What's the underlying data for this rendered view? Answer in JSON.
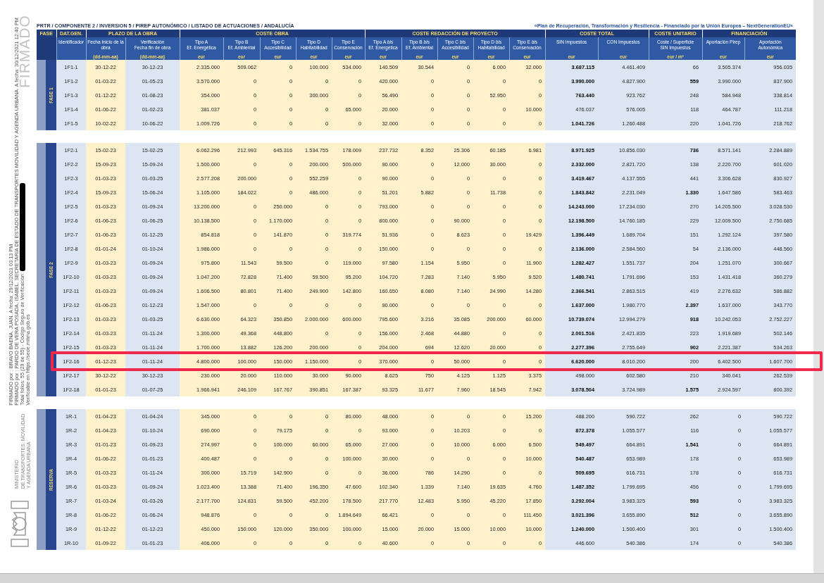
{
  "margin": {
    "stamp": "FIRMADO",
    "ministry": [
      "MINISTERIO",
      "DE TRANSPORTES, MOVILIDAD",
      "Y AGENDA URBANA"
    ],
    "signature_lines": [
      {
        "text": "FIRMADO por : BRAVO BAENA, JUAN. A fecha: 29/12/2021 03:13 PM",
        "redaction": false
      },
      {
        "text": "FIRMADO por : PARDO DE VERA POSADA, ISABEL. SECRETARIA DE ESTADO DE TRANSPORTES MOVILIDAD Y AGENDA URBANA. A fecha: 30/12/2021 12:40 PM",
        "redaction": false
      },
      {
        "text": "Total folios: 55 (29 de 55) - Código Seguro de Verificación:",
        "redaction": true
      },
      {
        "text": "Verificable en https://sede.mitma.gob.es",
        "redaction": false
      }
    ]
  },
  "breadcrumb": "PRTR / COMPONENTE 2 / INVERSION 5 / PIREP AUTONÓMICO / LISTADO DE ACTUACIONES / ANDALUCÍA",
  "funding_note": "«Plan de Recuperación, Transformación y Resiliencia - Financiado por la Unión Europea – NextGenerationEU»",
  "table": {
    "phase_header": "FASE",
    "groups": [
      {
        "label": "DAT.GEN."
      },
      {
        "label": "PLAZO DE LA OBRA"
      },
      {
        "label": "COSTE OBRA"
      },
      {
        "label": "COSTE REDACCIÓN DE PROYECTO"
      },
      {
        "label": "COSTE TOTAL"
      },
      {
        "label": "COSTE UNITARIO"
      },
      {
        "label": "FINANCIACIÓN"
      }
    ],
    "columns": [
      {
        "label": "Identificador"
      },
      {
        "label": "Fecha inicio de la\nobra",
        "unit": "(dd-mm-aa)"
      },
      {
        "label": "Verificación\nFecha fin de obra",
        "unit": "(dd-mm-aa)"
      },
      {
        "label": "Tipo A\nEf. Energética",
        "unit": "eur"
      },
      {
        "label": "Tipo B\nEf. Ambiental",
        "unit": "eur"
      },
      {
        "label": "Tipo C\nAccesibilidad",
        "unit": "eur"
      },
      {
        "label": "Tipo D\nHabitabilidad",
        "unit": "eur"
      },
      {
        "label": "Tipo E\nConservación",
        "unit": "eur"
      },
      {
        "label": "Tipo A *bis*\nEf. Energética",
        "unit": "eur"
      },
      {
        "label": "Tipo B *bis*\nEf. Ambiental",
        "unit": "eur"
      },
      {
        "label": "Tipo C *bis*\nAccesibilidad",
        "unit": "eur"
      },
      {
        "label": "Tipo D *bis*\nHabitabilidad",
        "unit": "eur"
      },
      {
        "label": "Tipo E *bis*\nConservación",
        "unit": "eur"
      },
      {
        "label": "SIN Impuestos",
        "unit": "eur"
      },
      {
        "label": "CON Impuestos",
        "unit": "eur"
      },
      {
        "label": "Coste / Superficie\nSIN Impuestos",
        "unit": "eur / m²"
      },
      {
        "label": "Aportación Pirep",
        "unit": "eur"
      },
      {
        "label": "Aportación\nAutonómica",
        "unit": "eur"
      }
    ],
    "sections": [
      {
        "label": "FASE 1",
        "rows": [
          {
            "cells": [
              "1F1-1",
              "30-12-22",
              "30-12-23",
              "2.335.000",
              "509.062",
              "0",
              "100.000",
              "534.000",
              "140.509",
              "30.544",
              "0",
              "6.000",
              "32.000",
              "3.687.115",
              "4.461.409",
              "66",
              "3.505.374",
              "956.035"
            ],
            "sin_bold": true,
            "unit_bold": false,
            "highlighted": false
          },
          {
            "cells": [
              "1F1-2",
              "01-03-22",
              "01-05-23",
              "3.570.000",
              "0",
              "0",
              "0",
              "0",
              "420.000",
              "0",
              "0",
              "0",
              "0",
              "3.990.000",
              "4.827.900",
              "559",
              "3.990.000",
              "837.900"
            ],
            "sin_bold": true,
            "unit_bold": true,
            "highlighted": false
          },
          {
            "cells": [
              "1F1-3",
              "01-12-22",
              "01-08-23",
              "354.000",
              "0",
              "0",
              "300.000",
              "0",
              "56.490",
              "0",
              "0",
              "52.950",
              "0",
              "763.440",
              "923.762",
              "248",
              "584.948",
              "338.814"
            ],
            "sin_bold": true,
            "unit_bold": false,
            "highlighted": false
          },
          {
            "cells": [
              "1F1-4",
              "01-06-22",
              "01-02-23",
              "381.037",
              "0",
              "0",
              "0",
              "65.000",
              "20.000",
              "0",
              "0",
              "0",
              "10.000",
              "476.037",
              "576.005",
              "118",
              "464.787",
              "111.218"
            ],
            "sin_bold": false,
            "unit_bold": false,
            "highlighted": false
          },
          {
            "cells": [
              "1F1-5",
              "10-02-22",
              "10-06-22",
              "1.009.726",
              "0",
              "0",
              "0",
              "0",
              "32.000",
              "0",
              "0",
              "0",
              "0",
              "1.041.726",
              "1.260.488",
              "220",
              "1.041.726",
              "218.762"
            ],
            "sin_bold": true,
            "unit_bold": false,
            "highlighted": false
          }
        ]
      },
      {
        "label": "FASE 2",
        "rows": [
          {
            "cells": [
              "1F2-1",
              "15-02-23",
              "15-02-25",
              "6.062.296",
              "212.993",
              "645.316",
              "1.534.755",
              "178.009",
              "237.732",
              "8.352",
              "25.306",
              "60.185",
              "6.981",
              "8.971.925",
              "10.856.030",
              "736",
              "8.571.141",
              "2.284.889"
            ],
            "sin_bold": true,
            "unit_bold": true,
            "highlighted": false
          },
          {
            "cells": [
              "1F2-2",
              "15-09-23",
              "15-09-24",
              "1.500.000",
              "0",
              "0",
              "200.000",
              "500.000",
              "90.000",
              "0",
              "12.000",
              "30.000",
              "0",
              "2.332.000",
              "2.821.720",
              "138",
              "2.220.700",
              "601.020"
            ],
            "sin_bold": true,
            "unit_bold": false,
            "highlighted": false
          },
          {
            "cells": [
              "1F2-3",
              "01-03-23",
              "01-03-25",
              "2.577.208",
              "200.000",
              "0",
              "552.259",
              "0",
              "90.000",
              "0",
              "0",
              "0",
              "0",
              "3.419.467",
              "4.137.555",
              "441",
              "3.306.628",
              "830.927"
            ],
            "sin_bold": true,
            "unit_bold": false,
            "highlighted": false
          },
          {
            "cells": [
              "1F2-4",
              "15-09-23",
              "15-06-24",
              "1.105.000",
              "184.022",
              "0",
              "486.000",
              "0",
              "51.201",
              "5.882",
              "0",
              "11.738",
              "0",
              "1.843.842",
              "2.231.049",
              "1.330",
              "1.647.586",
              "583.463"
            ],
            "sin_bold": true,
            "unit_bold": true,
            "highlighted": false
          },
          {
            "cells": [
              "1F2-5",
              "01-03-23",
              "01-09-24",
              "13.200.000",
              "0",
              "250.000",
              "0",
              "0",
              "793.000",
              "0",
              "0",
              "0",
              "0",
              "14.243.000",
              "17.234.030",
              "270",
              "14.205.500",
              "3.028.530"
            ],
            "sin_bold": true,
            "unit_bold": false,
            "highlighted": false
          },
          {
            "cells": [
              "1F2-6",
              "01-06-23",
              "01-06-25",
              "10.138.500",
              "0",
              "1.170.000",
              "0",
              "0",
              "800.000",
              "0",
              "90.000",
              "0",
              "0",
              "12.198.500",
              "14.760.185",
              "229",
              "12.009.500",
              "2.750.685"
            ],
            "sin_bold": true,
            "unit_bold": false,
            "highlighted": false
          },
          {
            "cells": [
              "1F2-7",
              "01-06-23",
              "01-12-25",
              "854.818",
              "0",
              "141.870",
              "0",
              "319.774",
              "51.936",
              "0",
              "8.623",
              "0",
              "19.429",
              "1.396.449",
              "1.689.704",
              "151",
              "1.292.124",
              "397.580"
            ],
            "sin_bold": true,
            "unit_bold": false,
            "highlighted": false
          },
          {
            "cells": [
              "1F2-8",
              "01-01-24",
              "01-10-24",
              "1.986.000",
              "0",
              "0",
              "0",
              "0",
              "150.000",
              "0",
              "0",
              "0",
              "0",
              "2.136.000",
              "2.584.560",
              "54",
              "2.136.000",
              "448.560"
            ],
            "sin_bold": true,
            "unit_bold": false,
            "highlighted": false
          },
          {
            "cells": [
              "1F2-9",
              "01-03-23",
              "01-09-24",
              "975.800",
              "11.543",
              "59.500",
              "0",
              "119.000",
              "97.580",
              "1.154",
              "5.950",
              "0",
              "11.900",
              "1.282.427",
              "1.551.737",
              "204",
              "1.251.070",
              "300.667"
            ],
            "sin_bold": true,
            "unit_bold": false,
            "highlighted": false
          },
          {
            "cells": [
              "1F2-10",
              "01-03-23",
              "01-09-24",
              "1.047.200",
              "72.828",
              "71.400",
              "59.500",
              "95.200",
              "104.720",
              "7.283",
              "7.140",
              "5.950",
              "9.520",
              "1.480.741",
              "1.791.696",
              "153",
              "1.431.418",
              "360.279"
            ],
            "sin_bold": true,
            "unit_bold": false,
            "highlighted": false
          },
          {
            "cells": [
              "1F2-11",
              "01-03-23",
              "01-09-24",
              "1.606.500",
              "80.801",
              "71.400",
              "249.900",
              "142.800",
              "160.650",
              "8.080",
              "7.140",
              "24.990",
              "14.280",
              "2.366.541",
              "2.863.515",
              "419",
              "2.276.632",
              "586.882"
            ],
            "sin_bold": true,
            "unit_bold": false,
            "highlighted": false
          },
          {
            "cells": [
              "1F2-12",
              "01-06-23",
              "01-12-23",
              "1.547.000",
              "0",
              "0",
              "0",
              "0",
              "90.000",
              "0",
              "0",
              "0",
              "0",
              "1.637.000",
              "1.980.770",
              "2.397",
              "1.637.000",
              "343.770"
            ],
            "sin_bold": true,
            "unit_bold": true,
            "highlighted": false
          },
          {
            "cells": [
              "1F2-13",
              "01-03-23",
              "01-03-25",
              "6.630.000",
              "64.323",
              "350.850",
              "2.000.000",
              "600.000",
              "795.600",
              "3.216",
              "35.085",
              "200.000",
              "60.000",
              "10.739.074",
              "12.994.279",
              "918",
              "10.242.053",
              "2.752.227"
            ],
            "sin_bold": true,
            "unit_bold": true,
            "highlighted": false
          },
          {
            "cells": [
              "1F2-14",
              "01-03-23",
              "01-11-24",
              "1.300.000",
              "49.368",
              "448.800",
              "0",
              "0",
              "156.000",
              "2.468",
              "44.880",
              "0",
              "0",
              "2.001.516",
              "2.421.835",
              "223",
              "1.919.689",
              "502.146"
            ],
            "sin_bold": true,
            "unit_bold": false,
            "highlighted": false
          },
          {
            "cells": [
              "1F2-15",
              "01-03-23",
              "01-11-24",
              "1.700.000",
              "13.882",
              "126.200",
              "200.000",
              "0",
              "204.000",
              "694",
              "12.620",
              "20.000",
              "0",
              "2.277.396",
              "2.755.649",
              "902",
              "2.221.387",
              "534.263"
            ],
            "sin_bold": true,
            "unit_bold": true,
            "highlighted": false
          },
          {
            "cells": [
              "1F2-16",
              "01-12-23",
              "01-11-24",
              "4.800.000",
              "100.000",
              "150.000",
              "1.150.000",
              "0",
              "370.000",
              "0",
              "50.000",
              "0",
              "0",
              "6.620.000",
              "8.010.200",
              "200",
              "6.402.500",
              "1.607.700"
            ],
            "sin_bold": true,
            "unit_bold": false,
            "highlighted": true
          },
          {
            "cells": [
              "1F2-17",
              "30-12-22",
              "30-12-23",
              "230.000",
              "20.000",
              "110.000",
              "30.000",
              "90.000",
              "8.625",
              "750",
              "4.125",
              "1.125",
              "3.375",
              "498.000",
              "602.580",
              "210",
              "340.041",
              "262.539"
            ],
            "sin_bold": false,
            "unit_bold": false,
            "highlighted": false
          },
          {
            "cells": [
              "1F2-18",
              "01-01-23",
              "01-07-25",
              "1.966.941",
              "246.109",
              "167.767",
              "390.851",
              "167.387",
              "93.325",
              "11.677",
              "7.960",
              "18.545",
              "7.942",
              "3.078.504",
              "3.724.989",
              "1.575",
              "2.924.597",
              "800.392"
            ],
            "sin_bold": true,
            "unit_bold": true,
            "highlighted": false
          }
        ]
      },
      {
        "label": "RESERVA",
        "rows": [
          {
            "cells": [
              "1R-1",
              "01-04-23",
              "01-04-24",
              "345.000",
              "0",
              "0",
              "0",
              "80.000",
              "48.000",
              "0",
              "0",
              "0",
              "15.200",
              "488.200",
              "590.722",
              "262",
              "0",
              "590.722"
            ],
            "sin_bold": false,
            "unit_bold": false,
            "highlighted": false
          },
          {
            "cells": [
              "1R-2",
              "01-04-23",
              "01-10-24",
              "690.000",
              "0",
              "79.175",
              "0",
              "0",
              "93.000",
              "0",
              "10.203",
              "0",
              "0",
              "872.378",
              "1.055.577",
              "116",
              "0",
              "1.055.577"
            ],
            "sin_bold": true,
            "unit_bold": false,
            "highlighted": false
          },
          {
            "cells": [
              "1R-3",
              "01-01-23",
              "01-09-23",
              "274.997",
              "0",
              "100.000",
              "60.000",
              "65.000",
              "27.000",
              "0",
              "10.000",
              "6.000",
              "6.500",
              "549.497",
              "664.891",
              "1.541",
              "0",
              "664.891"
            ],
            "sin_bold": true,
            "unit_bold": true,
            "highlighted": false
          },
          {
            "cells": [
              "1R-4",
              "01-06-22",
              "01-01-23",
              "400.487",
              "0",
              "0",
              "0",
              "100.000",
              "30.000",
              "0",
              "0",
              "0",
              "10.000",
              "540.487",
              "653.989",
              "178",
              "0",
              "653.989"
            ],
            "sin_bold": true,
            "unit_bold": false,
            "highlighted": false
          },
          {
            "cells": [
              "1R-5",
              "01-03-23",
              "01-11-24",
              "300.000",
              "15.719",
              "142.900",
              "0",
              "0",
              "36.000",
              "786",
              "14.290",
              "0",
              "0",
              "509.695",
              "616.731",
              "178",
              "0",
              "616.731"
            ],
            "sin_bold": true,
            "unit_bold": false,
            "highlighted": false
          },
          {
            "cells": [
              "1R-6",
              "01-03-23",
              "01-09-24",
              "1.023.400",
              "13.388",
              "71.400",
              "196.350",
              "47.600",
              "102.340",
              "1.339",
              "7.140",
              "19.635",
              "4.760",
              "1.487.352",
              "1.799.695",
              "456",
              "0",
              "1.799.695"
            ],
            "sin_bold": true,
            "unit_bold": false,
            "highlighted": false
          },
          {
            "cells": [
              "1R-7",
              "01-03-24",
              "01-03-26",
              "2.177.700",
              "124.831",
              "59.500",
              "452.200",
              "178.500",
              "217.770",
              "12.483",
              "5.950",
              "45.220",
              "17.850",
              "3.292.004",
              "3.983.325",
              "593",
              "0",
              "3.983.325"
            ],
            "sin_bold": true,
            "unit_bold": true,
            "highlighted": false
          },
          {
            "cells": [
              "1R-8",
              "01-06-22",
              "01-06-24",
              "948.876",
              "0",
              "0",
              "0",
              "1.894.649",
              "66.421",
              "0",
              "0",
              "0",
              "111.450",
              "3.021.396",
              "3.655.890",
              "512",
              "0",
              "3.655.890"
            ],
            "sin_bold": true,
            "unit_bold": true,
            "highlighted": false
          },
          {
            "cells": [
              "1R-9",
              "01-12-22",
              "01-12-23",
              "450.000",
              "150.000",
              "120.000",
              "350.000",
              "100.000",
              "15.000",
              "20.000",
              "15.000",
              "10.000",
              "10.000",
              "1.240.000",
              "1.500.400",
              "301",
              "0",
              "1.500.400"
            ],
            "sin_bold": true,
            "unit_bold": false,
            "highlighted": false
          },
          {
            "cells": [
              "1R-10",
              "01-09-22",
              "01-01-23",
              "406.000",
              "0",
              "0",
              "0",
              "0",
              "40.600",
              "0",
              "0",
              "0",
              "0",
              "446.600",
              "540.386",
              "174",
              "0",
              "540.386"
            ],
            "sin_bold": false,
            "unit_bold": false,
            "highlighted": false
          }
        ]
      }
    ]
  }
}
